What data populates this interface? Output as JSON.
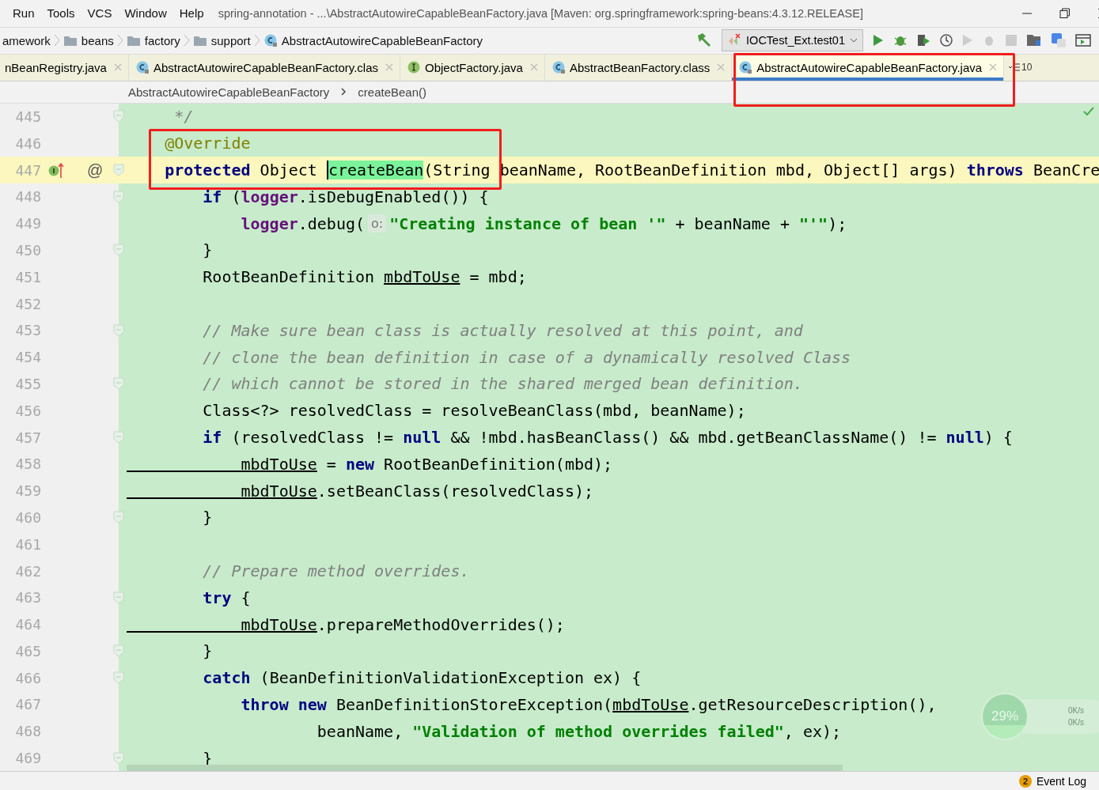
{
  "menu": [
    "Run",
    "Tools",
    "VCS",
    "Window",
    "Help"
  ],
  "window": {
    "title": "spring-annotation - ...\\AbstractAutowireCapableBeanFactory.java [Maven: org.springframework:spring-beans:4.3.12.RELEASE]"
  },
  "nav": [
    {
      "kind": "text",
      "label": "amework"
    },
    {
      "kind": "folder",
      "label": "beans"
    },
    {
      "kind": "folder",
      "label": "factory"
    },
    {
      "kind": "folder",
      "label": "support"
    },
    {
      "kind": "class",
      "label": "AbstractAutowireCapableBeanFactory"
    }
  ],
  "run_config": "IOCTest_Ext.test01",
  "tabs": [
    {
      "kind": "none",
      "label": "nBeanRegistry.java",
      "selected": false
    },
    {
      "kind": "class",
      "label": "AbstractAutowireCapableBeanFactory.clas",
      "selected": false
    },
    {
      "kind": "interface",
      "label": "ObjectFactory.java",
      "selected": false
    },
    {
      "kind": "class",
      "label": "AbstractBeanFactory.class",
      "selected": false
    },
    {
      "kind": "class",
      "label": "AbstractAutowireCapableBeanFactory.java",
      "selected": true
    }
  ],
  "hidden_tabs": "10",
  "breadcrumb": [
    "AbstractAutowireCapableBeanFactory",
    "createBean()"
  ],
  "lines": [
    {
      "number": "445",
      "fold": true,
      "current": false,
      "tokens": [
        {
          "kind": "comment",
          "text": "     */"
        }
      ]
    },
    {
      "number": "446",
      "fold": false,
      "current": false,
      "tokens": [
        {
          "kind": "annotation",
          "text": "    @Override"
        }
      ]
    },
    {
      "number": "447",
      "fold": true,
      "current": true,
      "gutter_mark": "@",
      "tokens": [
        {
          "kind": "keyword",
          "text": "    protected"
        },
        {
          "kind": "plain",
          "text": " Object "
        },
        {
          "kind": "match",
          "text": "createBean"
        },
        {
          "kind": "plain",
          "text": "(String beanName, RootBeanDefinition mbd, Object[] args) "
        },
        {
          "kind": "keyword",
          "text": "throws"
        },
        {
          "kind": "plain",
          "text": " BeanCre"
        }
      ]
    },
    {
      "number": "448",
      "fold": true,
      "current": false,
      "tokens": [
        {
          "kind": "keyword",
          "text": "        if"
        },
        {
          "kind": "plain",
          "text": " ("
        },
        {
          "kind": "field",
          "text": "logger"
        },
        {
          "kind": "plain",
          "text": ".isDebugEnabled()) {"
        }
      ]
    },
    {
      "number": "449",
      "fold": false,
      "current": false,
      "tokens": [
        {
          "kind": "field",
          "text": "            logger"
        },
        {
          "kind": "plain",
          "text": ".debug("
        },
        {
          "kind": "hint",
          "text": "o:"
        },
        {
          "kind": "string",
          "text": "\"Creating instance of bean '\""
        },
        {
          "kind": "plain",
          "text": " + beanName + "
        },
        {
          "kind": "string",
          "text": "\"'\""
        },
        {
          "kind": "plain",
          "text": ");"
        }
      ]
    },
    {
      "number": "450",
      "fold": true,
      "current": false,
      "tokens": [
        {
          "kind": "plain",
          "text": "        }"
        }
      ]
    },
    {
      "number": "451",
      "fold": false,
      "current": false,
      "tokens": [
        {
          "kind": "plain",
          "text": "        RootBeanDefinition "
        },
        {
          "kind": "var",
          "text": "mbdToUse"
        },
        {
          "kind": "plain",
          "text": " = mbd;"
        }
      ]
    },
    {
      "number": "452",
      "fold": false,
      "current": false
    },
    {
      "number": "453",
      "fold": true,
      "current": false,
      "tokens": [
        {
          "kind": "comment",
          "text": "        // Make sure bean class is actually resolved at this point, and"
        }
      ]
    },
    {
      "number": "454",
      "fold": false,
      "current": false,
      "tokens": [
        {
          "kind": "comment",
          "text": "        // clone the bean definition in case of a dynamically resolved Class"
        }
      ]
    },
    {
      "number": "455",
      "fold": true,
      "current": false,
      "tokens": [
        {
          "kind": "comment",
          "text": "        // which cannot be stored in the shared merged bean definition."
        }
      ]
    },
    {
      "number": "456",
      "fold": false,
      "current": false,
      "tokens": [
        {
          "kind": "plain",
          "text": "        Class<?> resolvedClass = resolveBeanClass(mbd, beanName);"
        }
      ]
    },
    {
      "number": "457",
      "fold": true,
      "current": false,
      "tokens": [
        {
          "kind": "keyword",
          "text": "        if"
        },
        {
          "kind": "plain",
          "text": " (resolvedClass != "
        },
        {
          "kind": "keyword",
          "text": "null"
        },
        {
          "kind": "plain",
          "text": " && !mbd.hasBeanClass() && mbd.getBeanClassName() != "
        },
        {
          "kind": "keyword",
          "text": "null"
        },
        {
          "kind": "plain",
          "text": ") {"
        }
      ]
    },
    {
      "number": "458",
      "fold": false,
      "current": false,
      "tokens": [
        {
          "kind": "var",
          "text": "            mbdToUse"
        },
        {
          "kind": "plain",
          "text": " = "
        },
        {
          "kind": "keyword",
          "text": "new"
        },
        {
          "kind": "plain",
          "text": " RootBeanDefinition(mbd);"
        }
      ]
    },
    {
      "number": "459",
      "fold": false,
      "current": false,
      "tokens": [
        {
          "kind": "var",
          "text": "            mbdToUse"
        },
        {
          "kind": "plain",
          "text": ".setBeanClass(resolvedClass);"
        }
      ]
    },
    {
      "number": "460",
      "fold": true,
      "current": false,
      "tokens": [
        {
          "kind": "plain",
          "text": "        }"
        }
      ]
    },
    {
      "number": "461",
      "fold": false,
      "current": false
    },
    {
      "number": "462",
      "fold": false,
      "current": false,
      "tokens": [
        {
          "kind": "comment",
          "text": "        // Prepare method overrides."
        }
      ]
    },
    {
      "number": "463",
      "fold": true,
      "current": false,
      "tokens": [
        {
          "kind": "keyword",
          "text": "        try"
        },
        {
          "kind": "plain",
          "text": " {"
        }
      ]
    },
    {
      "number": "464",
      "fold": false,
      "current": false,
      "tokens": [
        {
          "kind": "var",
          "text": "            mbdToUse"
        },
        {
          "kind": "plain",
          "text": ".prepareMethodOverrides();"
        }
      ]
    },
    {
      "number": "465",
      "fold": true,
      "current": false,
      "tokens": [
        {
          "kind": "plain",
          "text": "        }"
        }
      ]
    },
    {
      "number": "466",
      "fold": true,
      "current": false,
      "tokens": [
        {
          "kind": "keyword",
          "text": "        catch"
        },
        {
          "kind": "plain",
          "text": " (BeanDefinitionValidationException ex) {"
        }
      ]
    },
    {
      "number": "467",
      "fold": false,
      "current": false,
      "tokens": [
        {
          "kind": "keyword",
          "text": "            throw new"
        },
        {
          "kind": "plain",
          "text": " BeanDefinitionStoreException("
        },
        {
          "kind": "var",
          "text": "mbdToUse"
        },
        {
          "kind": "plain",
          "text": ".getResourceDescription(),"
        }
      ]
    },
    {
      "number": "468",
      "fold": false,
      "current": false,
      "tokens": [
        {
          "kind": "plain",
          "text": "                    beanName, "
        },
        {
          "kind": "string",
          "text": "\"Validation of method overrides failed\""
        },
        {
          "kind": "plain",
          "text": ", ex);"
        }
      ]
    },
    {
      "number": "469",
      "fold": true,
      "current": false,
      "tokens": [
        {
          "kind": "plain",
          "text": "        }"
        }
      ]
    }
  ],
  "speed_widget": {
    "percent": "29%",
    "up": "0K/s",
    "down": "0K/s"
  },
  "status_bar": {
    "badge": "2",
    "label": "Event Log"
  }
}
